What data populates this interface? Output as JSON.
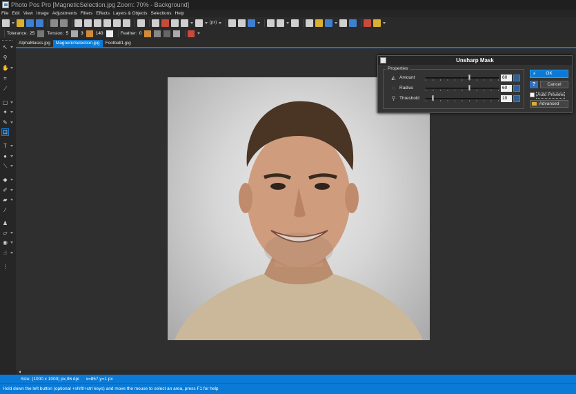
{
  "window": {
    "title": "Photo Pos Pro [MagneticSelection.jpg Zoom: 70% - Background]"
  },
  "menu": [
    "File",
    "Edit",
    "View",
    "Image",
    "Adjustments",
    "Filters",
    "Effects",
    "Layers & Objects",
    "Selections",
    "Help"
  ],
  "toolbar": {
    "unit_label": "(px)"
  },
  "tool_options": {
    "tolerance_label": "Tolerance:",
    "tolerance_value": "25",
    "tension_label": "Tension:",
    "tension_value": "5",
    "value_3": "3",
    "value_140": "140",
    "feather_label": "Feather:",
    "feather_value": "0"
  },
  "tabs": [
    {
      "label": "AlphaMasks.jpg",
      "active": false
    },
    {
      "label": "MagneticSelection.jpg",
      "active": true
    },
    {
      "label": "Football1.jpg",
      "active": false
    }
  ],
  "dialog": {
    "title": "Unsharp Mask",
    "group_label": "Properties",
    "properties": [
      {
        "label": "Amount",
        "value": "60",
        "level": 0.6,
        "icon": "amount-icon"
      },
      {
        "label": "Radius",
        "value": "60",
        "level": 0.6,
        "icon": "radius-icon"
      },
      {
        "label": "Threshold",
        "value": "10",
        "level": 0.1,
        "icon": "threshold-icon"
      }
    ],
    "ok_label": "OK",
    "help_label": "?",
    "cancel_label": "Cancel",
    "autopreview_label": "Auto Preview",
    "advanced_label": "Advanced"
  },
  "status": {
    "size": "Size: (1000 x 1000) px,96 dpi",
    "coords": "x=857,y=1 px",
    "hint": "Hold down the left button (optional +shift/+ctrl keys) and move the mouse to select an area, press F1 for help"
  },
  "colors": {
    "accent": "#0a7ad6",
    "background": "#2f2f2f",
    "panel": "#333333"
  }
}
